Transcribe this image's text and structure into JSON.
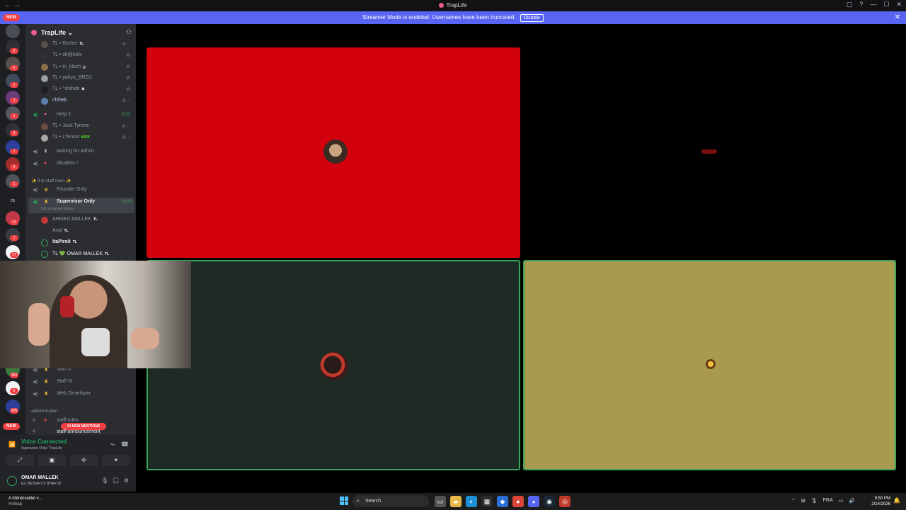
{
  "window": {
    "title": "TrapLife",
    "nav_label": "← →",
    "controls": [
      "▢",
      "?",
      "—",
      "☐",
      "✕"
    ]
  },
  "banner": {
    "message": "Streamer Mode is enabled. Usernames have been truncated.",
    "disable_label": "Disable",
    "close_label": "✕"
  },
  "rail": {
    "new_label": "NEW",
    "badges": [
      "2",
      "6",
      "1",
      "2",
      "1",
      "3",
      "1",
      "2",
      "1",
      "1",
      "12",
      "1",
      "27",
      "354",
      "5",
      "605"
    ],
    "text_server": "rs"
  },
  "sidebar": {
    "server_name": "TrapLife",
    "server_chevron": "⌄",
    "members_top": [
      {
        "label": "TL • RaYen",
        "tag": "TL"
      },
      {
        "label": "TL • sh@kofx",
        "tag": ""
      },
      {
        "label": "TL • tn_klach",
        "tag": "ꦿ"
      },
      {
        "label": "TL • yahya_BRO1",
        "tag": ""
      },
      {
        "label": "TL • ^chiheb",
        "tag": "☠"
      },
      {
        "label": "chiheb",
        "tag": ""
      }
    ],
    "help_channel": {
      "label": "Help-1",
      "time": "9:32"
    },
    "help_members": [
      {
        "label": "TL • Jack Tyrone",
        "tag": ""
      },
      {
        "label": "TL • L'fenssi",
        "tag": "KICK"
      }
    ],
    "channels_mid": [
      {
        "label": "waiting for admin"
      },
      {
        "label": "situation I"
      }
    ],
    "staff_category": "✨ tl rp staff room ✨",
    "founder_channel": "Founder Only",
    "supervisor_channel": {
      "label": "Supervisor Only",
      "time": "16:56",
      "status": "Set a channel status"
    },
    "supervisor_members": [
      {
        "label": "AHMED MALLEK",
        "tag": "TL"
      },
      {
        "label": "Asal",
        "tag": "TL"
      },
      {
        "label": "ItaPiroli",
        "tag": "TL"
      },
      {
        "label": "TL 💚 OMAR MALLEK",
        "tag": "TL"
      }
    ],
    "staff_channels": [
      {
        "label": "Staff II"
      },
      {
        "label": "Staff III"
      },
      {
        "label": "Web Developer"
      }
    ],
    "admin_category": "administration",
    "admin_channels": [
      {
        "label": "staff-rules"
      },
      {
        "label": "staff-announcement"
      }
    ],
    "mentions_pill": "24 NEW MENTIONS",
    "new_label": "NEW"
  },
  "voice": {
    "title": "Voice Connected",
    "subtitle": "Supervisor Only / TrapLife",
    "buttons": [
      "⤢",
      "▣",
      "✣",
      "✦"
    ]
  },
  "user": {
    "name": "OMAR MALLEK",
    "status": "ELI BEDNA YJI NHAR W"
  },
  "tiles": [
    {
      "name": "tile-red",
      "color": "#d3000e"
    },
    {
      "name": "tile-black",
      "color": "#000000"
    },
    {
      "name": "tile-dark-green",
      "color": "#1e2a24"
    },
    {
      "name": "tile-olive",
      "color": "#a89a4e"
    }
  ],
  "taskbar": {
    "weather_title": "A hőmérséklet v...",
    "weather_sub": "Holnap",
    "search_label": "Search",
    "lang": "FRA",
    "time": "9:50 PM",
    "date": "2/14/2026"
  }
}
